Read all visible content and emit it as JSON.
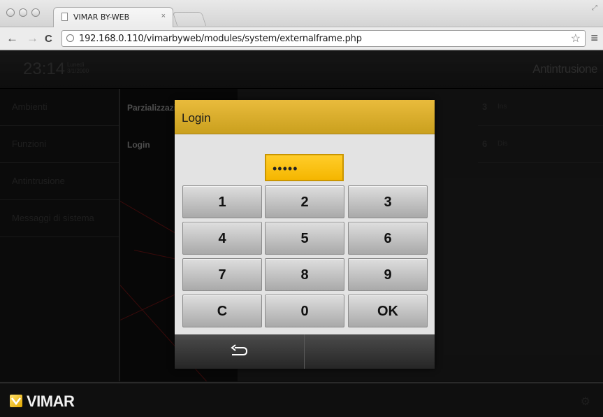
{
  "browser": {
    "tab_title": "VIMAR BY-WEB",
    "tab_close": "×",
    "url": "192.168.0.110/vimarbyweb/modules/system/externalframe.php",
    "back_glyph": "←",
    "forward_glyph": "→",
    "reload_glyph": "C",
    "star_glyph": "☆",
    "menu_glyph": "≡"
  },
  "header": {
    "time": "23:14",
    "day": "Lunedì",
    "date": "3/1/2000",
    "section": "Antintrusione"
  },
  "sidebar": {
    "items": [
      {
        "label": "Ambienti"
      },
      {
        "label": "Funzioni"
      },
      {
        "label": "Antintrusione"
      },
      {
        "label": "Messaggi di sistema"
      }
    ]
  },
  "middle": {
    "items": [
      {
        "label": "Parzializzazioni"
      },
      {
        "label": "Login"
      }
    ]
  },
  "right_rows": [
    {
      "num": "3",
      "text": "Ins"
    },
    {
      "num": "6",
      "text": "Dis"
    }
  ],
  "dialog": {
    "title": "Login",
    "pin_value": "•••••",
    "keys": [
      "1",
      "2",
      "3",
      "4",
      "5",
      "6",
      "7",
      "8",
      "9",
      "C",
      "0",
      "OK"
    ],
    "back_icon": "return-arrow-icon"
  },
  "footer": {
    "brand": "VIMAR",
    "gear_glyph": "⚙"
  },
  "colors": {
    "accent": "#f5b600",
    "header_gold": "#d9ad2e"
  }
}
